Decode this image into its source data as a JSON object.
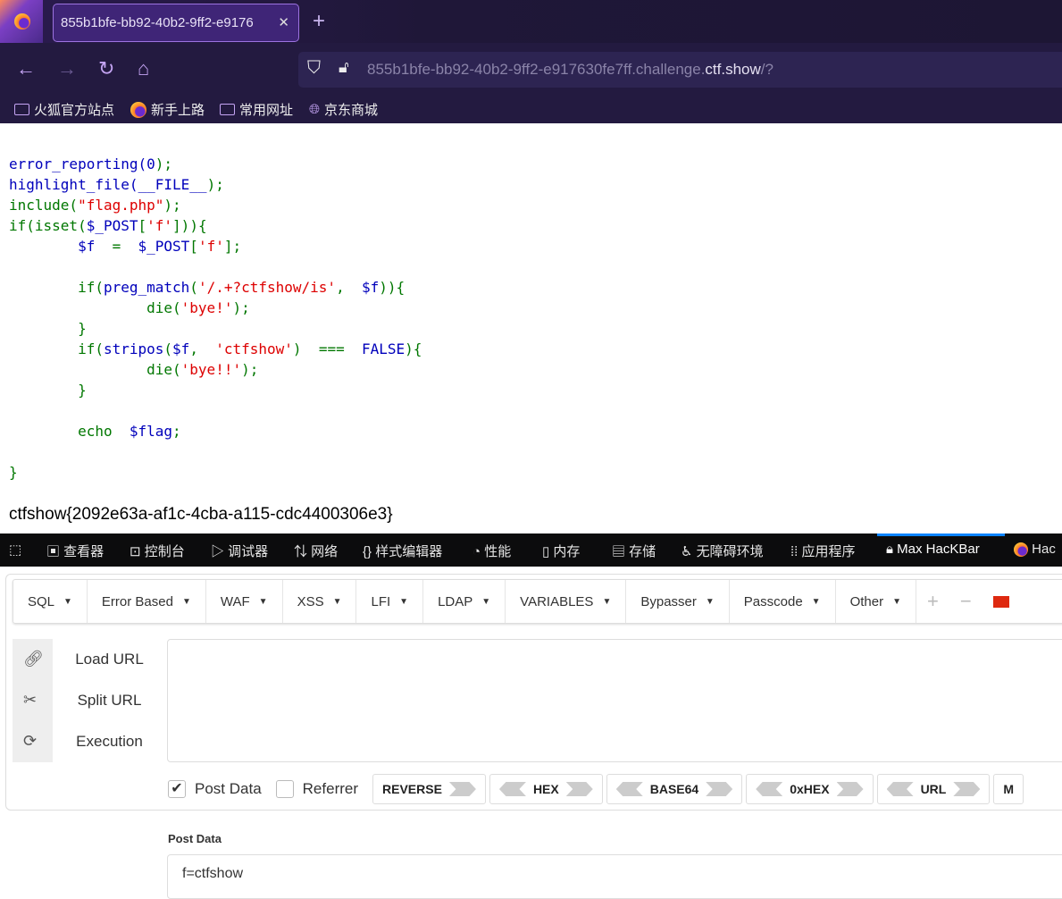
{
  "browser": {
    "tab_title": "855b1bfe-bb92-40b2-9ff2-e9176",
    "url_prefix": "855b1bfe-bb92-40b2-9ff2-e917630fe7ff.challenge.",
    "url_domain": "ctf.show",
    "url_suffix": "/?",
    "bookmarks": [
      "火狐官方站点",
      "新手上路",
      "常用网址",
      "京东商城"
    ]
  },
  "code": [
    [
      [
        "error_reporting(",
        "v"
      ],
      [
        "0",
        "v"
      ],
      [
        ");",
        "k"
      ]
    ],
    [
      [
        "highlight_file(__FILE__",
        "v"
      ],
      [
        ");",
        "k"
      ]
    ],
    [
      [
        "include(",
        "k"
      ],
      [
        "\"flag.php\"",
        "s"
      ],
      [
        ");",
        "k"
      ]
    ],
    [
      [
        "if(isset(",
        "k"
      ],
      [
        "$_POST",
        "v"
      ],
      [
        "[",
        "k"
      ],
      [
        "'f'",
        "s"
      ],
      [
        "])){",
        "k"
      ]
    ],
    [
      [
        "        ",
        "k"
      ],
      [
        "$f",
        "v"
      ],
      [
        "  =  ",
        "k"
      ],
      [
        "$_POST",
        "v"
      ],
      [
        "[",
        "k"
      ],
      [
        "'f'",
        "s"
      ],
      [
        "];",
        "k"
      ]
    ],
    [],
    [
      [
        "        if(",
        "k"
      ],
      [
        "preg_match",
        "v"
      ],
      [
        "(",
        "k"
      ],
      [
        "'/.+?ctfshow/is'",
        "s"
      ],
      [
        ",  ",
        "k"
      ],
      [
        "$f",
        "v"
      ],
      [
        ")){",
        "k"
      ]
    ],
    [
      [
        "                die(",
        "k"
      ],
      [
        "'bye!'",
        "s"
      ],
      [
        ");",
        "k"
      ]
    ],
    [
      [
        "        }",
        "k"
      ]
    ],
    [
      [
        "        if(",
        "k"
      ],
      [
        "stripos",
        "v"
      ],
      [
        "(",
        "k"
      ],
      [
        "$f",
        "v"
      ],
      [
        ",  ",
        "k"
      ],
      [
        "'ctfshow'",
        "s"
      ],
      [
        ")  ===  ",
        "k"
      ],
      [
        "FALSE",
        "v"
      ],
      [
        "){",
        "k"
      ]
    ],
    [
      [
        "                die(",
        "k"
      ],
      [
        "'bye!!'",
        "s"
      ],
      [
        ");",
        "k"
      ]
    ],
    [
      [
        "        }",
        "k"
      ]
    ],
    [],
    [
      [
        "        echo  ",
        "k"
      ],
      [
        "$flag",
        "v"
      ],
      [
        ";",
        "k"
      ]
    ],
    [],
    [
      [
        "}",
        "k"
      ]
    ]
  ],
  "flag_output": "ctfshow{2092e63a-af1c-4cba-a115-cdc4400306e3}",
  "devtools": {
    "tabs": [
      "查看器",
      "控制台",
      "调试器",
      "网络",
      "样式编辑器",
      "性能",
      "内存",
      "存储",
      "无障碍环境",
      "应用程序",
      "Max HacKBar",
      "Hac"
    ],
    "active": "Max HacKBar"
  },
  "hackbar": {
    "menu": [
      "SQL",
      "Error Based",
      "WAF",
      "XSS",
      "LFI",
      "LDAP",
      "VARIABLES",
      "Bypasser",
      "Passcode",
      "Other"
    ],
    "actions": [
      "Load URL",
      "Split URL",
      "Execution"
    ],
    "post_data_checkbox": "Post Data",
    "referrer_checkbox": "Referrer",
    "encoders": [
      "REVERSE",
      "HEX",
      "BASE64",
      "0xHEX",
      "URL",
      "M"
    ],
    "post_data_label": "Post Data",
    "post_data_value": "f=ctfshow",
    "url_value": ""
  }
}
